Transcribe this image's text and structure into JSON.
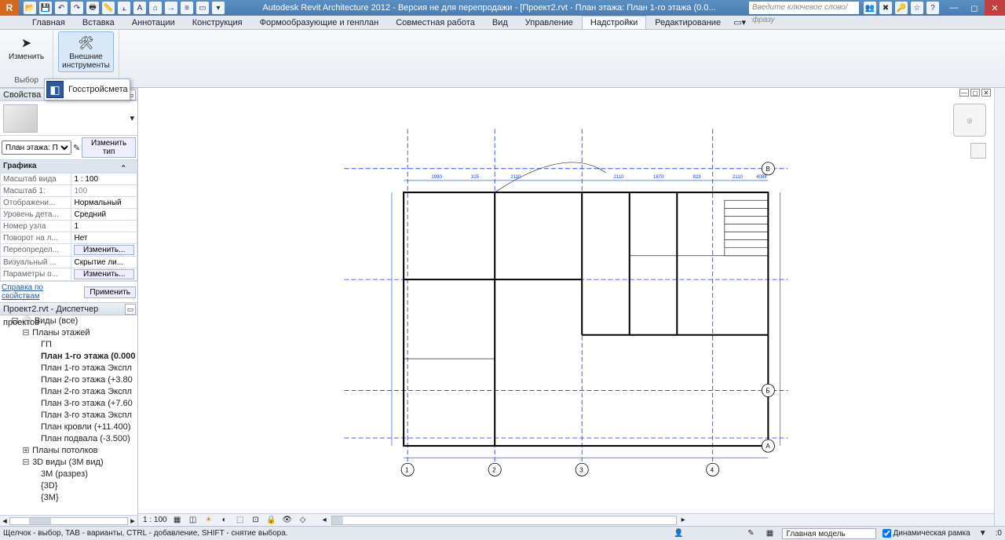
{
  "titlebar": {
    "app_title": "Autodesk Revit Architecture 2012 - Версия не для перепродажи - [Проект2.rvt - План этажа: План 1-го этажа (0.0...",
    "search_placeholder": "Введите ключевое слово/фразу"
  },
  "ribbon": {
    "tabs": [
      "Главная",
      "Вставка",
      "Аннотации",
      "Конструкция",
      "Формообразующие и генплан",
      "Совместная работа",
      "Вид",
      "Управление",
      "Надстройки",
      "Редактирование"
    ],
    "active_tab": "Надстройки",
    "groups": {
      "select": {
        "btn": "Изменить",
        "label": "Выбор"
      },
      "external": {
        "btn": "Внешние\nинструменты",
        "label": ""
      }
    },
    "dropdown_item": "Госстройсмета"
  },
  "properties": {
    "title": "Свойства",
    "type_selector": "План этажа: П",
    "edit_type": "Изменить тип",
    "section": "Графика",
    "rows": [
      {
        "k": "Масштаб вида",
        "v": "1 : 100",
        "editable": true
      },
      {
        "k": "Масштаб    1:",
        "v": "100",
        "editable": false
      },
      {
        "k": "Отображени...",
        "v": "Нормальный",
        "editable": true
      },
      {
        "k": "Уровень дета...",
        "v": "Средний",
        "editable": true
      },
      {
        "k": "Номер узла",
        "v": "1",
        "editable": true
      },
      {
        "k": "Поворот на л...",
        "v": "Нет",
        "editable": true
      },
      {
        "k": "Переопредел...",
        "v": "Изменить...",
        "btn": true
      },
      {
        "k": "Визуальный ...",
        "v": "Скрытие ли...",
        "editable": true
      },
      {
        "k": "Параметры о...",
        "v": "Изменить...",
        "btn": true
      }
    ],
    "help_link": "Справка по свойствам",
    "apply": "Применить"
  },
  "browser": {
    "title": "Проект2.rvt - Диспетчер проектов",
    "root": "Виды (все)",
    "groups": [
      {
        "name": "Планы этажей",
        "open": true,
        "items": [
          "ГП",
          "План 1-го этажа (0.000",
          "План 1-го этажа Экспл",
          "План 2-го этажа (+3.80",
          "План 2-го этажа Экспл",
          "План 3-го этажа (+7.60",
          "План 3-го этажа Экспл",
          "План кровли (+11.400)",
          "План подвала (-3.500)"
        ],
        "selected": 1
      },
      {
        "name": "Планы потолков",
        "open": false,
        "items": []
      },
      {
        "name": "3D виды (3М вид)",
        "open": true,
        "items": [
          "3М (разрез)",
          "{3D}",
          "{3М}"
        ]
      }
    ]
  },
  "viewbar": {
    "scale": "1 : 100"
  },
  "statusbar": {
    "hint": "Щелчок - выбор, TAB - варианты, CTRL - добавление, SHIFT - снятие выбора.",
    "model_combo": "Главная модель",
    "dyn_frame": "Динамическая рамка"
  },
  "plan": {
    "grid_bubbles_bottom": [
      "1",
      "2",
      "3",
      "4"
    ],
    "grid_bubbles_right": [
      "В",
      "Б",
      "А"
    ]
  }
}
